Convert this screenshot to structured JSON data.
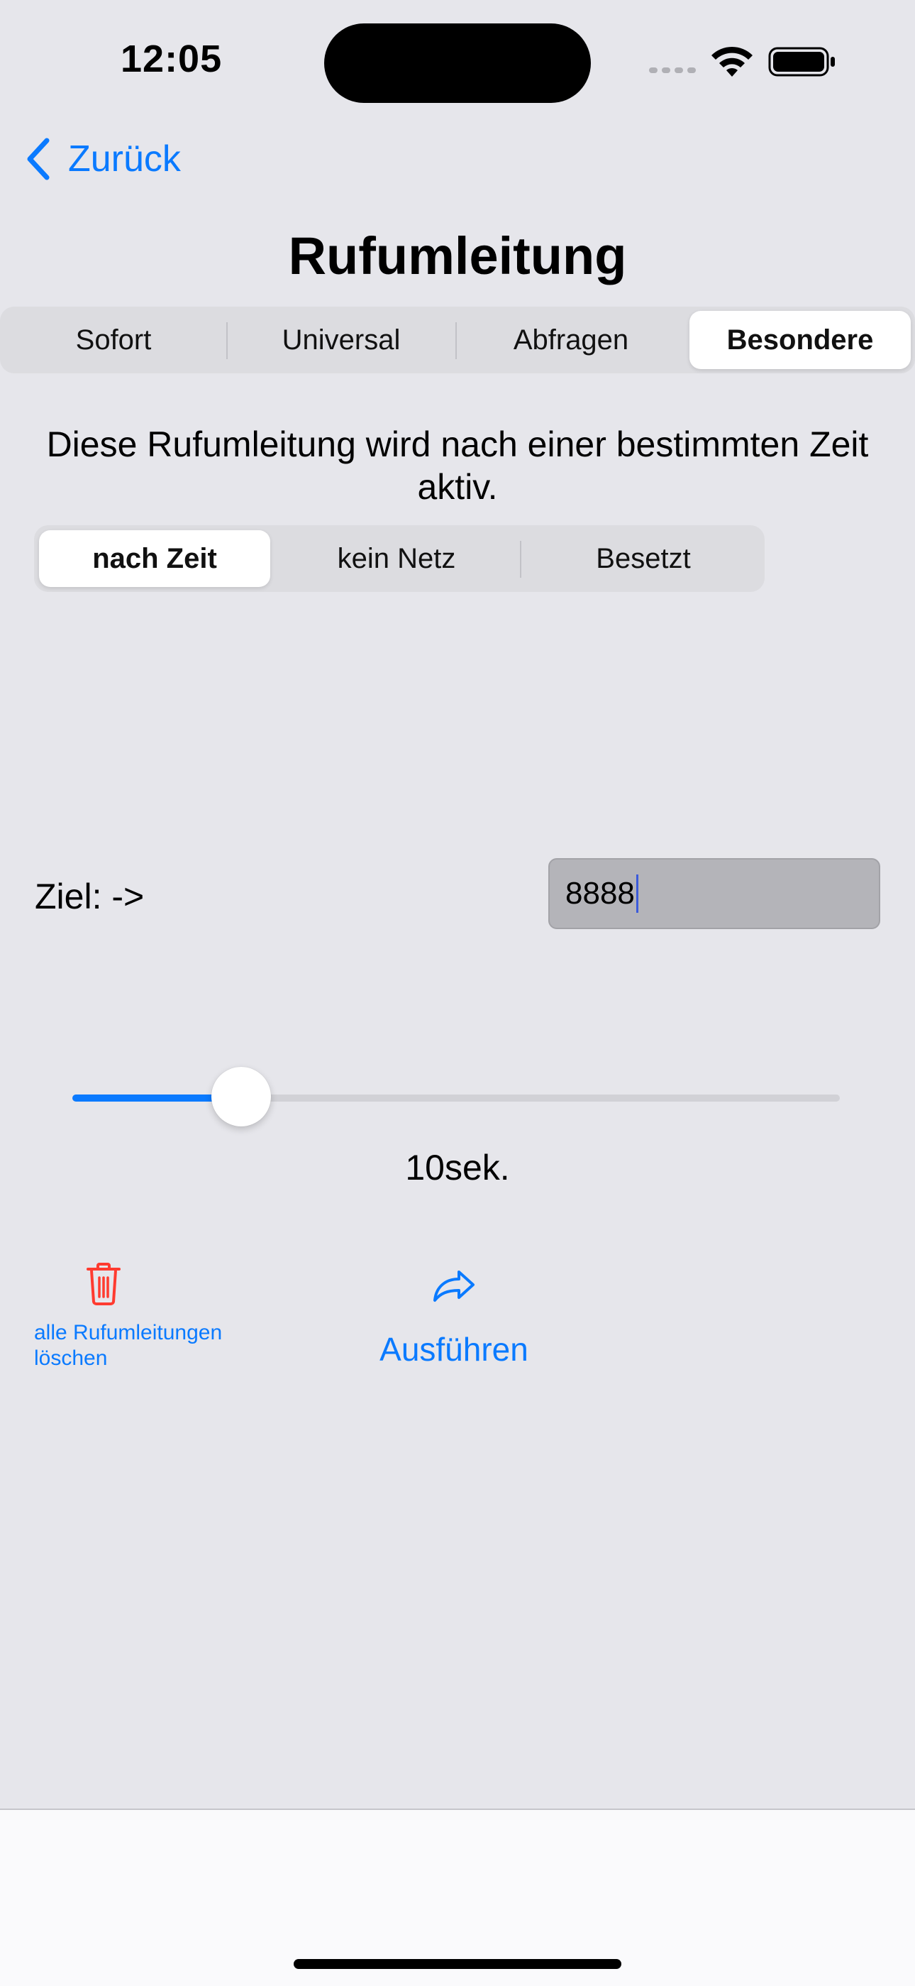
{
  "status_bar": {
    "time": "12:05"
  },
  "nav": {
    "back_label": "Zurück",
    "title": "Rufumleitung"
  },
  "tabs": {
    "items": [
      {
        "label": "Sofort"
      },
      {
        "label": "Universal"
      },
      {
        "label": "Abfragen"
      },
      {
        "label": "Besondere"
      }
    ],
    "selected": "Besondere"
  },
  "description": "Diese Rufumleitung wird nach einer bestimmten Zeit aktiv.",
  "subtabs": {
    "items": [
      {
        "label": "nach Zeit"
      },
      {
        "label": "kein Netz"
      },
      {
        "label": "Besetzt"
      }
    ],
    "selected": "nach Zeit"
  },
  "target": {
    "label": "Ziel: ->",
    "value": "8888"
  },
  "slider": {
    "value_label": "10sek.",
    "fraction": 0.22
  },
  "actions": {
    "delete_label": "alle Rufumleitungen löschen",
    "run_label": "Ausführen"
  },
  "colors": {
    "accent": "#0a7aff",
    "destructive": "#ff3b30",
    "background": "#e6e6eb"
  }
}
